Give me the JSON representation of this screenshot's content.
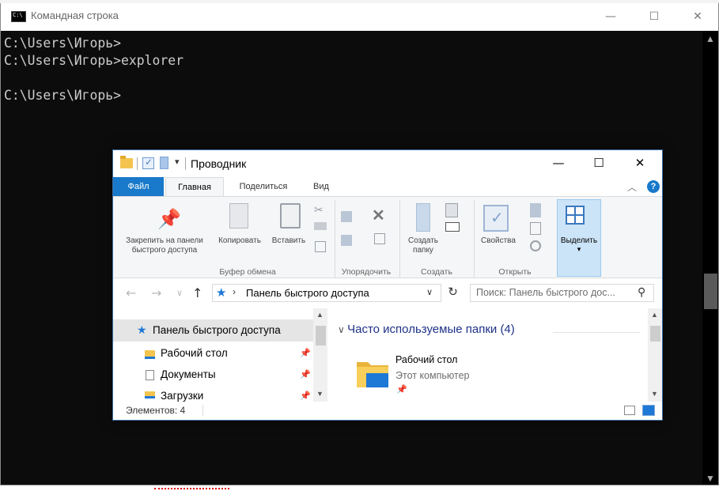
{
  "console": {
    "title": "Командная строка",
    "minimize": "—",
    "maximize": "☐",
    "close": "✕",
    "lines": "C:\\Users\\Игорь>\nC:\\Users\\Игорь>explorer\n\nC:\\Users\\Игорь>"
  },
  "explorer": {
    "title": "Проводник",
    "minimize": "—",
    "maximize": "☐",
    "close": "✕",
    "tabs": {
      "file": "Файл",
      "home": "Главная",
      "share": "Поделиться",
      "view": "Вид"
    },
    "ribbon": {
      "pin_label": "Закрепить на панели быстрого доступа",
      "copy_label": "Копировать",
      "paste_label": "Вставить",
      "clipboard_group": "Буфер обмена",
      "organize_group": "Упорядочить",
      "new_folder_label": "Создать папку",
      "create_group": "Создать",
      "properties_label": "Свойства",
      "open_group": "Открыть",
      "select_label": "Выделить"
    },
    "address": {
      "path": "Панель быстрого доступа",
      "search_placeholder": "Поиск: Панель быстрого дос..."
    },
    "nav": {
      "items": [
        {
          "label": "Панель быстрого доступа"
        },
        {
          "label": "Рабочий стол"
        },
        {
          "label": "Документы"
        },
        {
          "label": "Загрузки"
        }
      ]
    },
    "content": {
      "section_header": "Часто используемые папки (4)",
      "folder_name": "Рабочий стол",
      "folder_location": "Этот компьютер"
    },
    "status": {
      "count": "Элементов: 4"
    }
  },
  "colors": {
    "accent": "#1979ca",
    "console_bg": "#0c0c0c",
    "console_text": "#cccccc",
    "selection": "#cce4f7"
  }
}
